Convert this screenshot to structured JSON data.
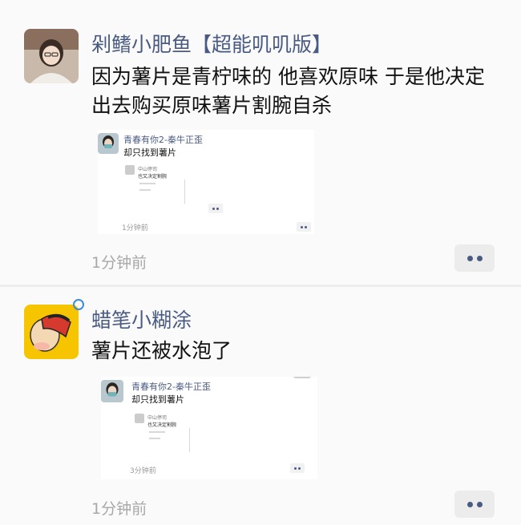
{
  "posts": [
    {
      "username": "剁鳍小肥鱼【超能叽叽版】",
      "content": "因为薯片是青柠味的 他喜欢原味 于是他决定出去购买原味薯片割腕自杀",
      "time": "1分钟前",
      "screenshot": {
        "name": "青春有你2-秦牛正歪",
        "text": "却只找到薯片",
        "inner_name": "中山停司",
        "inner_text": "也又决定割腕",
        "time": "1分钟前"
      }
    },
    {
      "username": "蜡笔小糊涂",
      "content": "薯片还被水泡了",
      "time": "1分钟前",
      "screenshot": {
        "name": "青春有你2-秦牛正歪",
        "text": "却只找到薯片",
        "inner_name": "中山停司",
        "inner_text": "也又决定割腕",
        "time": "3分钟前"
      }
    }
  ],
  "colors": {
    "username": "#4a5b83",
    "time": "#a8a8a8",
    "content": "#111111",
    "background": "#fafafa"
  },
  "icons": {
    "more": "more-dots-icon",
    "status": "status-ring-icon"
  }
}
